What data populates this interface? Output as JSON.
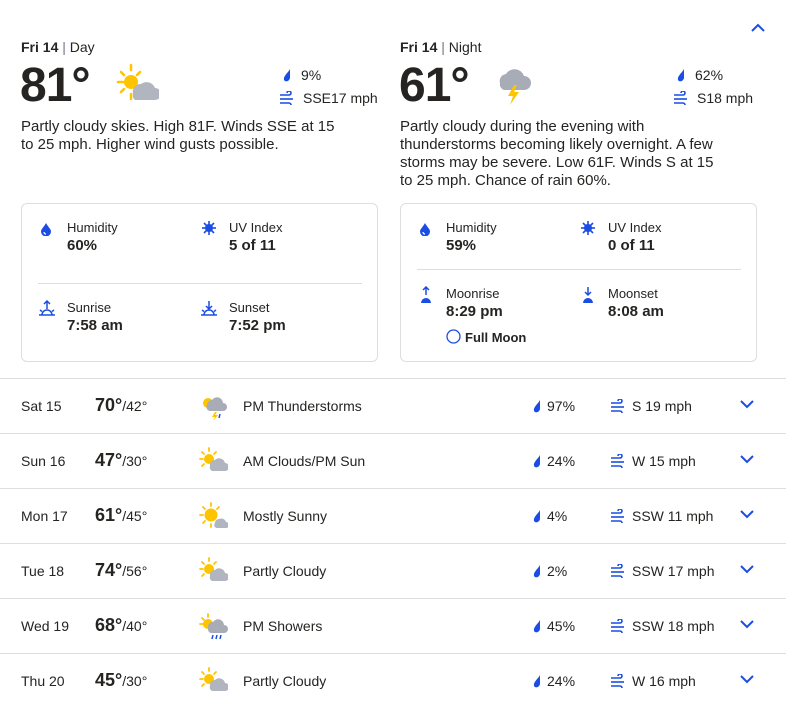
{
  "day": {
    "date": "Fri 14",
    "part": "Day",
    "temp": "81°",
    "precip": "9%",
    "wind": "SSE17 mph",
    "description": "Partly cloudy skies. High 81F. Winds SSE at 15 to 25 mph. Higher wind gusts possible.",
    "humidity_label": "Humidity",
    "humidity": "60%",
    "uv_label": "UV Index",
    "uv": "5 of 11",
    "sunrise_label": "Sunrise",
    "sunrise": "7:58 am",
    "sunset_label": "Sunset",
    "sunset": "7:52 pm"
  },
  "night": {
    "date": "Fri 14",
    "part": "Night",
    "temp": "61°",
    "precip": "62%",
    "wind": "S18 mph",
    "description": "Partly cloudy during the evening with thunderstorms becoming likely overnight. A few storms may be severe. Low 61F. Winds S at 15 to 25 mph. Chance of rain 60%.",
    "humidity_label": "Humidity",
    "humidity": "59%",
    "uv_label": "UV Index",
    "uv": "0 of 11",
    "moonrise_label": "Moonrise",
    "moonrise": "8:29 pm",
    "moonset_label": "Moonset",
    "moonset": "8:08 am",
    "moon_phase": "Full Moon"
  },
  "forecast": [
    {
      "day": "Sat 15",
      "hi": "70°",
      "lo": "/42°",
      "icon": "thunderstorm-icon",
      "cond": "PM Thunderstorms",
      "rain": "97%",
      "wind": "S 19 mph"
    },
    {
      "day": "Sun 16",
      "hi": "47°",
      "lo": "/30°",
      "icon": "partly-cloudy-icon",
      "cond": "AM Clouds/PM Sun",
      "rain": "24%",
      "wind": "W 15 mph"
    },
    {
      "day": "Mon 17",
      "hi": "61°",
      "lo": "/45°",
      "icon": "mostly-sunny-icon",
      "cond": "Mostly Sunny",
      "rain": "4%",
      "wind": "SSW 11 mph"
    },
    {
      "day": "Tue 18",
      "hi": "74°",
      "lo": "/56°",
      "icon": "partly-cloudy-icon",
      "cond": "Partly Cloudy",
      "rain": "2%",
      "wind": "SSW 17 mph"
    },
    {
      "day": "Wed 19",
      "hi": "68°",
      "lo": "/40°",
      "icon": "showers-icon",
      "cond": "PM Showers",
      "rain": "45%",
      "wind": "SSW 18 mph"
    },
    {
      "day": "Thu 20",
      "hi": "45°",
      "lo": "/30°",
      "icon": "partly-cloudy-icon",
      "cond": "Partly Cloudy",
      "rain": "24%",
      "wind": "W 16 mph"
    }
  ],
  "colors": {
    "accent": "#1b4de4",
    "sun": "#ffc400",
    "cloud": "#9aa0ac",
    "text": "#252422",
    "border": "#dedede"
  }
}
